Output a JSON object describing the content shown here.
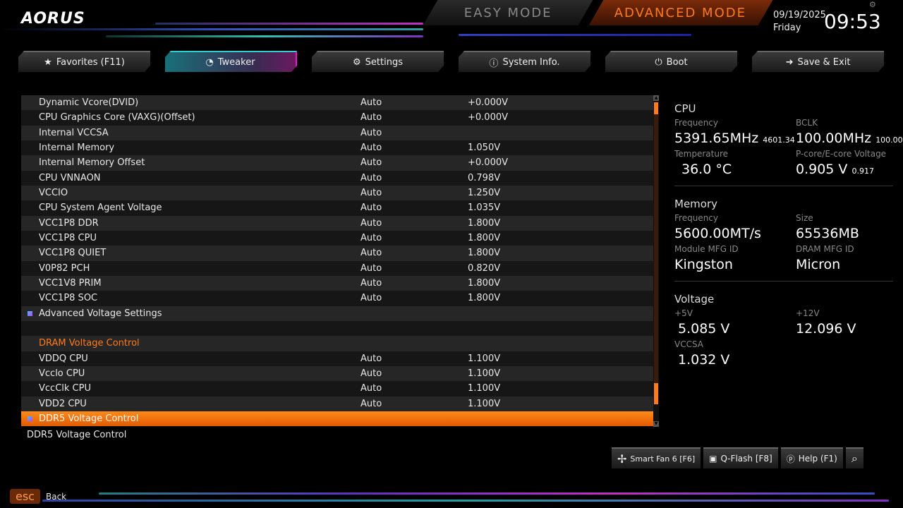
{
  "brand": "AORUS",
  "modes": {
    "easy": "EASY MODE",
    "advanced": "ADVANCED MODE"
  },
  "clock": {
    "date": "09/19/2025",
    "day": "Friday",
    "time": "09:53"
  },
  "tabs": [
    {
      "label": "Favorites (F11)",
      "icon": "★"
    },
    {
      "label": "Tweaker",
      "icon": "◔"
    },
    {
      "label": "Settings",
      "icon": "⚙"
    },
    {
      "label": "System Info.",
      "icon": "ⓘ"
    },
    {
      "label": "Boot",
      "icon": "⏻"
    },
    {
      "label": "Save & Exit",
      "icon": "➜"
    }
  ],
  "active_tab": 1,
  "settings": [
    {
      "name": "Dynamic Vcore(DVID)",
      "option": "Auto",
      "value": "+0.000V"
    },
    {
      "name": "CPU Graphics Core (VAXG)(Offset)",
      "option": "Auto",
      "value": "+0.000V"
    },
    {
      "name": "Internal VCCSA",
      "option": "Auto",
      "value": ""
    },
    {
      "name": "Internal Memory",
      "option": "Auto",
      "value": "1.050V"
    },
    {
      "name": "Internal Memory Offset",
      "option": "Auto",
      "value": "+0.000V"
    },
    {
      "name": "CPU VNNAON",
      "option": "Auto",
      "value": "0.798V"
    },
    {
      "name": "VCCIO",
      "option": "Auto",
      "value": "1.250V"
    },
    {
      "name": "CPU System Agent Voltage",
      "option": "Auto",
      "value": "1.035V"
    },
    {
      "name": "VCC1P8 DDR",
      "option": "Auto",
      "value": "1.800V"
    },
    {
      "name": "VCC1P8 CPU",
      "option": "Auto",
      "value": "1.800V"
    },
    {
      "name": "VCC1P8 QUIET",
      "option": "Auto",
      "value": "1.800V"
    },
    {
      "name": "V0P82 PCH",
      "option": "Auto",
      "value": "0.820V"
    },
    {
      "name": "VCC1V8 PRIM",
      "option": "Auto",
      "value": "1.800V"
    },
    {
      "name": "VCC1P8 SOC",
      "option": "Auto",
      "value": "1.800V"
    },
    {
      "name": "Advanced Voltage Settings",
      "type": "submenu"
    },
    {
      "name": "",
      "type": "blank"
    },
    {
      "name": "DRAM Voltage Control",
      "type": "header"
    },
    {
      "name": "VDDQ CPU",
      "option": "Auto",
      "value": "1.100V"
    },
    {
      "name": "Vcclo CPU",
      "option": "Auto",
      "value": "1.100V"
    },
    {
      "name": "VccClk CPU",
      "option": "Auto",
      "value": "1.100V"
    },
    {
      "name": "VDD2 CPU",
      "option": "Auto",
      "value": "1.100V"
    },
    {
      "name": "DDR5 Voltage Control",
      "type": "submenu",
      "selected": true
    }
  ],
  "description": "DDR5 Voltage Control",
  "scroll_position_fraction": 0.95,
  "info": {
    "cpu": {
      "title": "CPU",
      "freq_label": "Frequency",
      "freq": "5391.65MHz",
      "freq_sub": "4601.34",
      "bclk_label": "BCLK",
      "bclk": "100.00MHz",
      "bclk_sub": "100.00",
      "temp_label": "Temperature",
      "temp": "36.0 °C",
      "volt_label": "P-core/E-core Voltage",
      "volt": "0.905 V",
      "volt_sub": "0.917"
    },
    "memory": {
      "title": "Memory",
      "freq_label": "Frequency",
      "freq": "5600.00MT/s",
      "size_label": "Size",
      "size": "65536MB",
      "module_label": "Module MFG ID",
      "module": "Kingston",
      "dram_label": "DRAM MFG ID",
      "dram": "Micron"
    },
    "voltage": {
      "title": "Voltage",
      "p5_label": "+5V",
      "p5": "5.085 V",
      "p12_label": "+12V",
      "p12": "12.096 V",
      "vccsa_label": "VCCSA",
      "vccsa": "1.032 V"
    }
  },
  "bottom_buttons": {
    "smartfan": "Smart Fan 6 [F6]",
    "qflash": "Q-Flash [F8]",
    "help": "Help (F1)"
  },
  "esc": {
    "key": "esc",
    "label": "Back"
  },
  "colors": {
    "accent": "#ff7a1a",
    "teal": "#30d0d0",
    "magenta": "#e020c0"
  }
}
